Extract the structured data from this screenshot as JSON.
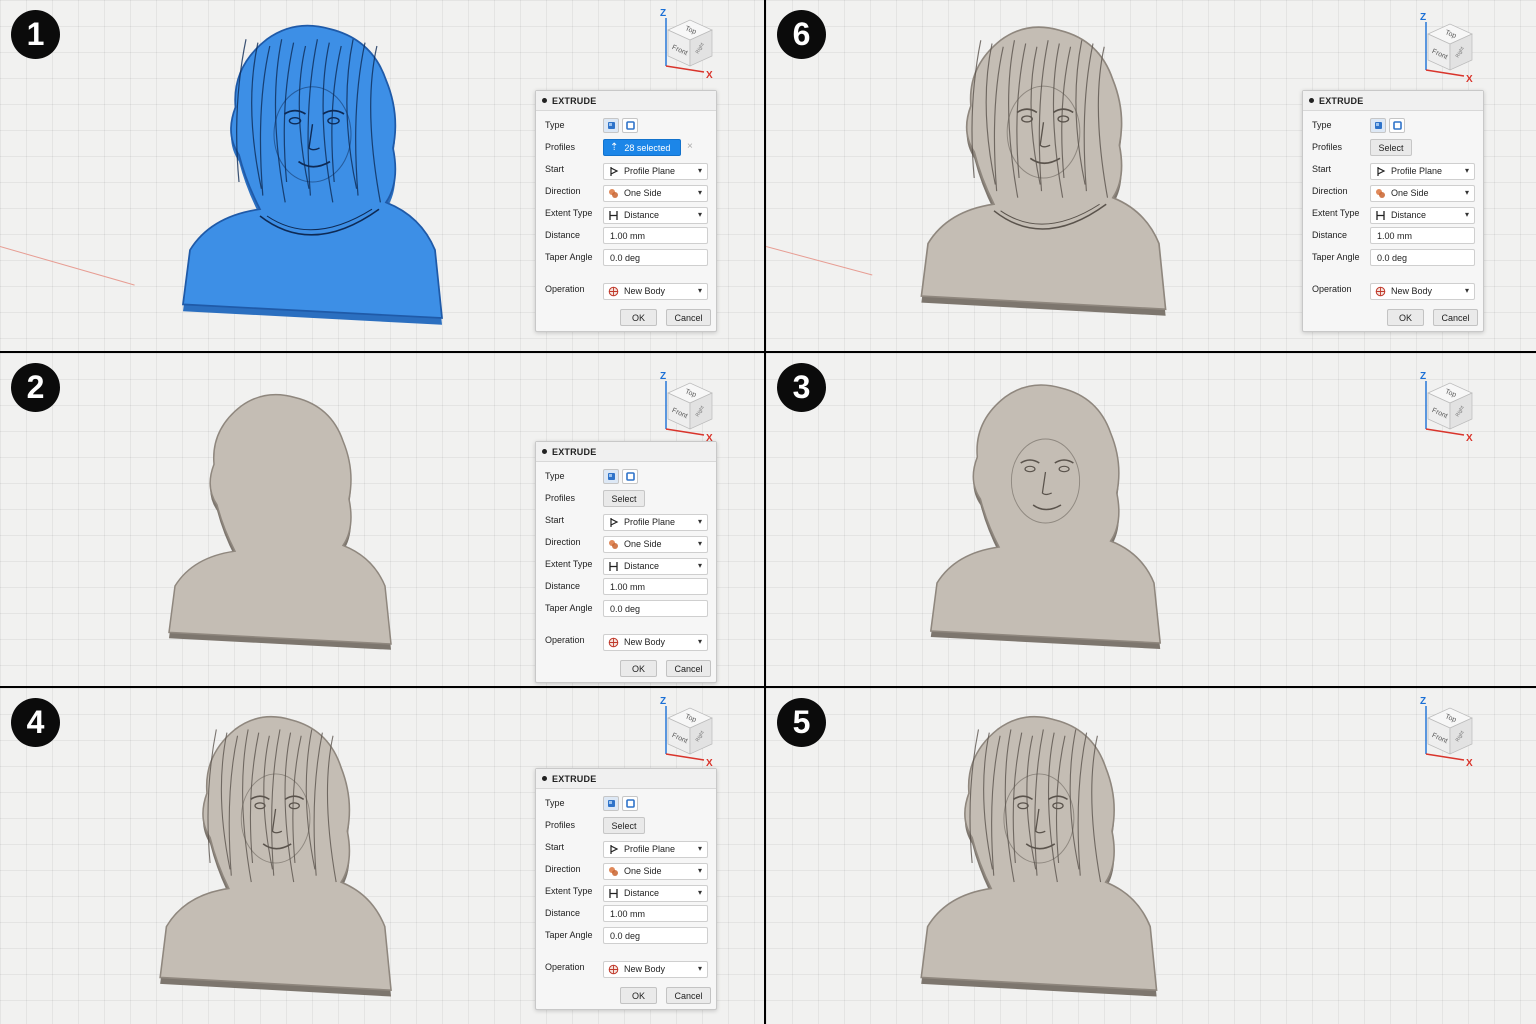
{
  "panels": [
    {
      "step": "1",
      "profiles_label": "28 selected",
      "profiles_state": "selected",
      "stage": "profiles"
    },
    {
      "step": "6",
      "profiles_label": "Select",
      "profiles_state": "select",
      "stage": "final"
    },
    {
      "step": "2",
      "profiles_label": "Select",
      "profiles_state": "select",
      "stage": "silhouette"
    },
    {
      "step": "3",
      "profiles_label": "Select",
      "profiles_state": "select",
      "stage": "face"
    },
    {
      "step": "4",
      "profiles_label": "Select",
      "profiles_state": "select",
      "stage": "hair"
    },
    {
      "step": "5",
      "profiles_label": "Select",
      "profiles_state": "select",
      "stage": "detail"
    }
  ],
  "dialog": {
    "title": "EXTRUDE",
    "labels": {
      "type": "Type",
      "profiles": "Profiles",
      "start": "Start",
      "direction": "Direction",
      "extent_type": "Extent Type",
      "distance": "Distance",
      "taper_angle": "Taper Angle",
      "operation": "Operation"
    },
    "values": {
      "start": "Profile Plane",
      "direction": "One Side",
      "extent_type": "Distance",
      "distance": "1.00 mm",
      "taper_angle": "0.0 deg",
      "operation": "New Body"
    },
    "ok": "OK",
    "cancel": "Cancel"
  },
  "viewcube": {
    "top": "Top",
    "front": "Front",
    "right": "Right",
    "z_axis": "Z",
    "x_axis": "X"
  },
  "colors": {
    "selection_blue": "#3d8fe6",
    "relief_gray": "#c4bdb4",
    "accent": "#1c86e8",
    "x_axis": "#d9342b",
    "z_axis": "#1a6fd6"
  }
}
